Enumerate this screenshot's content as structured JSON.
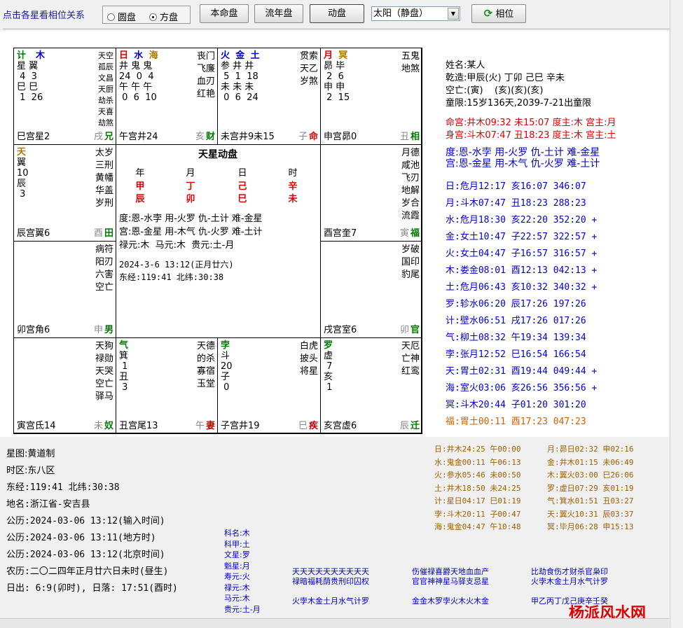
{
  "toolbar": {
    "hint": "点击各星看相位关系",
    "mode_circle": "圆盘",
    "mode_square": "方盘",
    "btn_natal": "本命盘",
    "btn_annual": "流年盘",
    "btn_dynamic": "动盘",
    "select_value": "太阳（静盘）",
    "btn_aspect": "相位"
  },
  "center": {
    "title": "天星动盘",
    "headers": [
      "年",
      "月",
      "日",
      "时"
    ],
    "stems": [
      "甲",
      "丁",
      "己",
      "辛"
    ],
    "branches": [
      "辰",
      "卯",
      "巳",
      "未"
    ],
    "line1": "度:恩-水孛 用-火罗 仇-土计 难-金星",
    "line2": "宫:恩-金星 用-木气 仇-火罗 难-土计",
    "line3": "禄元:木  马元:木  贵元:土-月",
    "line4": "2024-3-6 13:12(正月廿六)",
    "line5": "东经:119:41 北纬:30:38"
  },
  "cells": {
    "si": {
      "p1": "计",
      "p2": "木",
      "r1": "星 翼",
      "r2": " 4  3",
      "r3": "巳 巳",
      "r4": " 1  26",
      "stars": [
        "天空",
        "孤辰",
        "文昌",
        "天厨",
        "劫杀",
        "天喜",
        "劫煞"
      ],
      "label": "巳宫星2",
      "branch": "戌",
      "palace": "兄"
    },
    "wu": {
      "p1": "日",
      "p2": "水",
      "p3": "海",
      "r1": "井 鬼 鬼",
      "r2": "24  0  4",
      "r3": "午 午 午",
      "r4": " 0  6  10",
      "stars": [
        "丧门",
        "飞廉",
        "血刃",
        "红艳"
      ],
      "label": "午宫井24",
      "branch": "亥",
      "palace": "财"
    },
    "wei": {
      "p1": "火",
      "p2": "金",
      "p3": "土",
      "r1": "参 井 井",
      "r2": " 5  1  18",
      "r3": "未 未 未",
      "r4": " 0  6  24",
      "stars": [
        "贯索",
        "天乙",
        "岁煞"
      ],
      "label": "未宫井9未15",
      "branch": "子",
      "palace": "命"
    },
    "shen": {
      "p1": "月",
      "p2": "冥",
      "r1": "昴 毕",
      "r2": " 2  6",
      "r3": "申 申",
      "r4": " 2  15",
      "stars": [
        "五鬼",
        "地煞"
      ],
      "label": "申宫昴0",
      "branch": "丑",
      "palace": "相"
    },
    "chen": {
      "p1": "天",
      "r1": "翼",
      "r2": "10",
      "r3": "辰",
      "r4": " 3",
      "stars": [
        "太岁",
        "三刑",
        "黄幡",
        "华盖",
        "岁刑"
      ],
      "label": "辰宫翼6",
      "branch": "酉",
      "palace": "田"
    },
    "you": {
      "stars": [
        "月德",
        "咸池",
        "飞刃",
        "地解",
        "岁合",
        "流霞"
      ],
      "label": "酉宫奎7",
      "branch": "寅",
      "palace": "福"
    },
    "mao": {
      "stars": [
        "病符",
        "阳刃",
        "六害",
        "空亡"
      ],
      "label": "卯宫角6",
      "branch": "申",
      "palace": "男"
    },
    "xu": {
      "stars": [
        "岁破",
        "国印",
        "豹尾"
      ],
      "label": "戌宫室6",
      "branch": "卯",
      "palace": "官"
    },
    "yin": {
      "stars": [
        "天狗",
        "禄勋",
        "天哭",
        "空亡",
        "驿马"
      ],
      "label": "寅宫氐14",
      "branch": "未",
      "palace": "奴"
    },
    "chou": {
      "p1": "气",
      "r1": "箕",
      "r2": " 1",
      "r3": "丑",
      "r4": " 3",
      "stars": [
        "天德",
        "的杀",
        "寡宿",
        "玉堂"
      ],
      "label": "丑宫尾13",
      "branch": "午",
      "palace": "妻"
    },
    "zi": {
      "p1": "孛",
      "r1": "斗",
      "r2": "20",
      "r3": "子",
      "r4": " 0",
      "stars": [
        "白虎",
        "披头",
        "将星"
      ],
      "label": "子宫井19",
      "branch": "巳",
      "palace": "疾"
    },
    "hai": {
      "p1": "罗",
      "r1": "虚",
      "r2": " 7",
      "r3": "亥",
      "r4": " 1",
      "stars": [
        "天厄",
        "亡神",
        "红鸾"
      ],
      "label": "亥宫虚6",
      "branch": "辰",
      "palace": "迁"
    }
  },
  "info": {
    "name": "姓名:某人",
    "bazi": "乾造:甲辰(火) 丁卯 己巳 辛未",
    "kongwang": "空亡:(寅)    (亥)(亥)(亥)",
    "tongxian": "童限:15岁136天,2039-7-21出童限",
    "minggong": "命宫:井木09:32 未15:07 度主:木 宫主:月",
    "shengong": "身宫:斗木07:47 丑18:23 度主:木 宫主:土",
    "du": "度:恩-水孛 用-火罗 仇-土计 难-金星",
    "gong": "宫:恩-金星 用-木气 仇-火罗 难-土计"
  },
  "planets": [
    "日:危月12:17 亥16:07 346:07",
    "月:斗木07:47 丑18:23 288:23",
    "水:危月18:30 亥22:20 352:20 +",
    "金:女土10:47 子22:57 322:57 +",
    "火:女土04:47 子16:57 316:57 +",
    "木:娄金08:01 酉12:13 042:13 +",
    "土:危月06:43 亥10:32 340:32 +",
    "罗:轸水06:20 辰17:26 197:26",
    "计:壁水06:51 戌17:26 017:26",
    "气:柳土08:32 午19:34 139:34",
    "孛:张月12:52 巳16:54 166:54",
    "天:胃土02:31 酉19:44 049:44 +",
    "海:室火03:06 亥26:56 356:56 +",
    "冥:斗木20:44 子01:20 301:20",
    "福:胃土00:11 酉17:23 047:23"
  ],
  "transits_left": [
    "日:井木24:25 午00:00",
    "水:鬼金00:11 午06:13",
    "火:参水05:46 未00:50",
    "土:井木18:50 未24:25",
    "计:星日04:17 巳01:19",
    "孛:斗木20:11 子00:47",
    "海:鬼金04:47 午10:48"
  ],
  "transits_right": [
    "月:昴日02:32 申02:16",
    "金:井木01:15 未06:49",
    "木:翼火03:00 巳26:06",
    "罗:虚日07:29 亥01:19",
    "气:箕水01:51 丑03:27",
    "天:翼火10:31 辰03:37",
    "冥:毕月06:28 申15:13"
  ],
  "bottom": {
    "lines": [
      "星图:黄道制",
      "时区:东八区",
      "东经:119:41 北纬:30:38",
      "地名:浙江省-安吉县",
      "公历:2024-03-06 13:12(输入时间)",
      "公历:2024-03-06 13:11(地方时)",
      "公历:2024-03-06 13:12(北京时间)",
      "农历:二〇二四年正月廿六日未时(昼生)",
      "日出: 6:9(卯时), 日落: 17:51(酉时)"
    ],
    "small": [
      "科名:木",
      "科甲:土",
      "文星:罗",
      "魁星:月",
      "寿元:火",
      "禄元:木",
      "马元:木",
      "贵元:土-月"
    ],
    "star_row1a": "天天天天天天天天天天",
    "star_row1b": "禄暗福耗荫贵刑印囚权",
    "star_row1c": "火孛木金土月水气计罗",
    "star_row2a": "伤催禄喜爵天地血血产",
    "star_row2b": "官官神神星马驿支忌星",
    "star_row2c": "金金木罗孛火木火木金",
    "star_row3a": "比劫食伤才财杀官枭印",
    "star_row3b": "火孛木金土月水气计罗",
    "star_row3c": "甲乙丙丁戊己庚辛壬癸"
  },
  "logo": "杨派风水网",
  "colors": {
    "green": "#007a00",
    "blue": "#0000c8",
    "red": "#e00000",
    "orange": "#b07800"
  }
}
